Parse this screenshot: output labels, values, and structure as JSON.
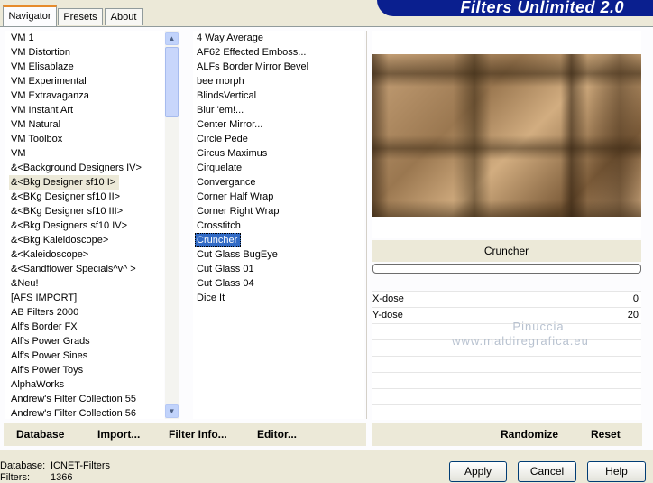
{
  "tabs": [
    "Navigator",
    "Presets",
    "About"
  ],
  "header_title": "Filters Unlimited 2.0",
  "categories": [
    "VM 1",
    "VM Distortion",
    "VM Elisablaze",
    "VM Experimental",
    "VM Extravaganza",
    "VM Instant Art",
    "VM Natural",
    "VM Toolbox",
    "VM",
    "&<Background Designers IV>",
    "&<Bkg Designer sf10 I>",
    "&<BKg Designer sf10 II>",
    "&<BKg Designer sf10 III>",
    "&<Bkg Designers sf10 IV>",
    "&<Bkg Kaleidoscope>",
    "&<Kaleidoscope>",
    "&<Sandflower Specials^v^ >",
    "&Neu!",
    "[AFS IMPORT]",
    "AB Filters 2000",
    "Alf's Border FX",
    "Alf's Power Grads",
    "Alf's Power Sines",
    "Alf's Power Toys",
    "AlphaWorks",
    "Andrew's Filter Collection 55",
    "Andrew's Filter Collection 56"
  ],
  "selected_category": "&<Bkg Designer sf10 I>",
  "filters": [
    "4 Way Average",
    "AF62 Effected Emboss...",
    "ALFs Border Mirror Bevel",
    "bee morph",
    "BlindsVertical",
    "Blur 'em!...",
    "Center Mirror...",
    "Circle Pede",
    "Circus Maximus",
    "Cirquelate",
    "Convergance",
    "Corner Half Wrap",
    "Corner Right Wrap",
    "Crosstitch",
    "Cruncher",
    "Cut Glass  BugEye",
    "Cut Glass 01",
    "Cut Glass 04",
    "Dice It"
  ],
  "selected_filter": "Cruncher",
  "preview_filter_name": "Cruncher",
  "sliders": [
    {
      "label": "X-dose",
      "value": "0",
      "level": 0
    },
    {
      "label": "Y-dose",
      "value": "20",
      "level": 0.08
    }
  ],
  "watermark": {
    "line1": "Pinuccia",
    "line2": "www.maldiregrafica.eu"
  },
  "left_buttons": [
    "Database",
    "Import...",
    "Filter Info...",
    "Editor..."
  ],
  "right_buttons": [
    "Randomize",
    "Reset"
  ],
  "status": {
    "database_label": "Database:",
    "database_value": "ICNET-Filters",
    "filters_label": "Filters:",
    "filters_value": "1366"
  },
  "dialog_buttons": {
    "apply": "Apply",
    "cancel": "Cancel",
    "help": "Help"
  },
  "colors": {
    "header": "#0a1f8f",
    "selection": "#316ac5",
    "tab_accent": "#e68b2c"
  }
}
